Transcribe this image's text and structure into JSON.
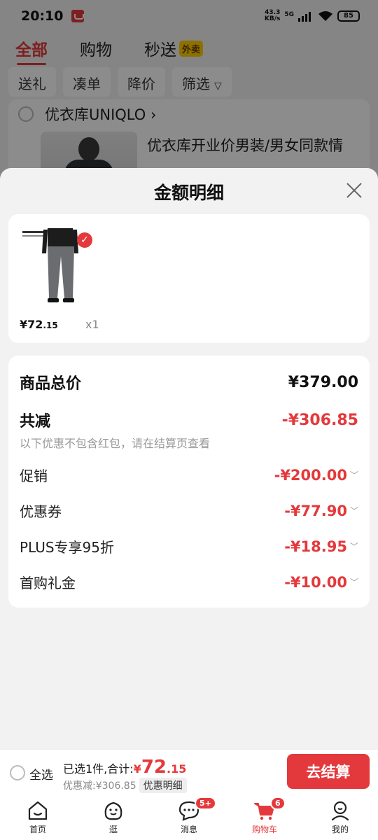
{
  "status_bar": {
    "time": "20:10",
    "net_speed_top": "43.3",
    "net_speed_bottom": "KB/s",
    "network": "5G",
    "battery": "85"
  },
  "background": {
    "tabs": [
      {
        "label": "全部"
      },
      {
        "label": "购物"
      },
      {
        "label": "秒送"
      }
    ],
    "waimai_badge": "外卖",
    "filters": [
      {
        "label": "送礼"
      },
      {
        "label": "凑单"
      },
      {
        "label": "降价"
      },
      {
        "label": "筛选"
      }
    ],
    "store_name": "优衣库UNIQLO ›",
    "product_title": "优衣库开业价男装/男女同款情"
  },
  "sheet": {
    "title": "金额明细",
    "item": {
      "price_int": "¥72",
      "price_dec": ".15",
      "qty": "x1"
    },
    "total_label": "商品总价",
    "total_value": "¥379.00",
    "reduce_label": "共减",
    "reduce_value": "-¥306.85",
    "note": "以下优惠不包含红包，请在结算页查看",
    "discounts": [
      {
        "label": "促销",
        "value": "-¥200.00"
      },
      {
        "label": "优惠券",
        "value": "-¥77.90"
      },
      {
        "label": "PLUS专享95折",
        "value": "-¥18.95"
      },
      {
        "label": "首购礼金",
        "value": "-¥10.00"
      }
    ]
  },
  "checkout": {
    "select_all": "全选",
    "summary_prefix": "已选1件,合计:",
    "total_cur": "¥",
    "total_int": "72",
    "total_dec": ".15",
    "discount_text": "优惠减:¥306.85",
    "detail_tag": "优惠明细",
    "button": "去结算"
  },
  "nav": [
    {
      "label": "首页",
      "icon": "home-icon"
    },
    {
      "label": "逛",
      "icon": "browse-icon"
    },
    {
      "label": "消息",
      "icon": "message-icon",
      "badge": "5+"
    },
    {
      "label": "购物车",
      "icon": "cart-icon",
      "badge": "6"
    },
    {
      "label": "我的",
      "icon": "profile-icon"
    }
  ],
  "colors": {
    "accent": "#e4393c",
    "waimai": "#ffcc00"
  }
}
